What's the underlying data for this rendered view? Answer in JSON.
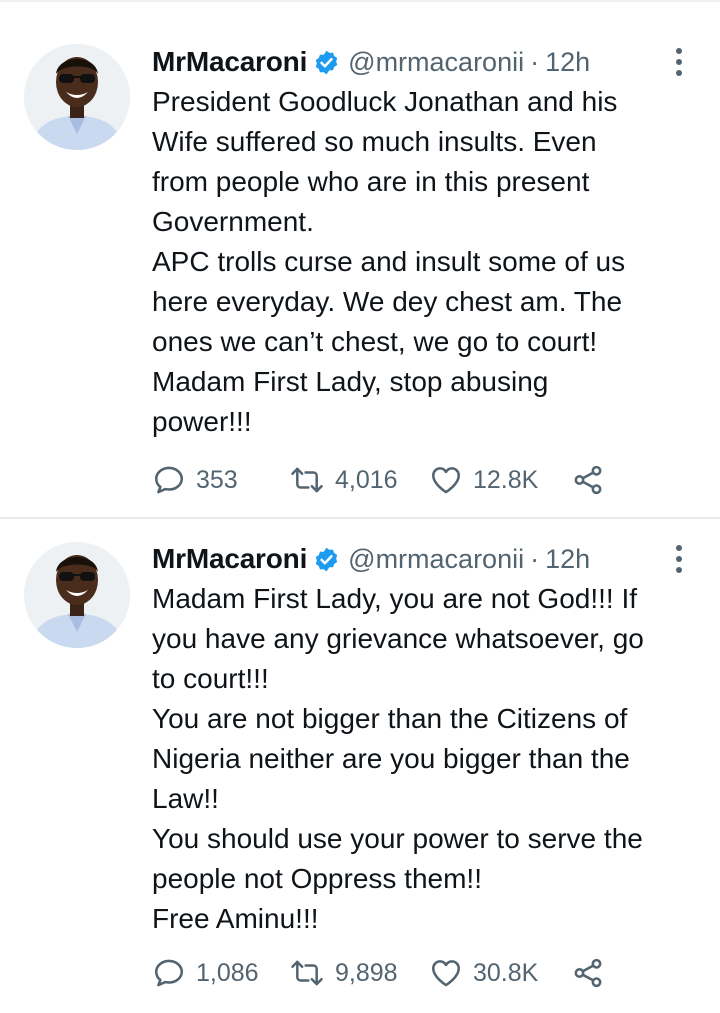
{
  "tweets": [
    {
      "name": "MrMacaroni",
      "handle": "@mrmacaronii",
      "separator": "·",
      "time": "12h",
      "lines": [
        "President Goodluck Jonathan and his",
        "Wife suffered so much insults. Even",
        "from people who are in this present",
        "Government.",
        "APC trolls curse and insult some of us",
        "here everyday. We dey chest am. The",
        "ones we can’t chest, we go to court!",
        "Madam First Lady, stop abusing",
        "power!!!"
      ],
      "replies": "353",
      "retweets": "4,016",
      "likes": "12.8K"
    },
    {
      "name": "MrMacaroni",
      "handle": "@mrmacaronii",
      "separator": "·",
      "time": "12h",
      "lines": [
        "Madam First Lady, you are not God!!! If",
        "you have any grievance whatsoever, go",
        "to court!!!",
        "You are not bigger than the Citizens of",
        "Nigeria neither are you bigger than the",
        "Law!!",
        "You should use your power to serve the",
        "people not Oppress them!!",
        "Free Aminu!!!"
      ],
      "replies": "1,086",
      "retweets": "9,898",
      "likes": "30.8K"
    }
  ],
  "icons": {
    "verified": "verified-badge-icon",
    "more": "more-vertical-icon",
    "reply": "reply-bubble-icon",
    "retweet": "retweet-icon",
    "like": "heart-icon",
    "share": "share-icon"
  },
  "colors": {
    "text": "#0f1419",
    "secondary": "#536471",
    "verified": "#1d9bf0",
    "divider": "#e7e9ea"
  }
}
